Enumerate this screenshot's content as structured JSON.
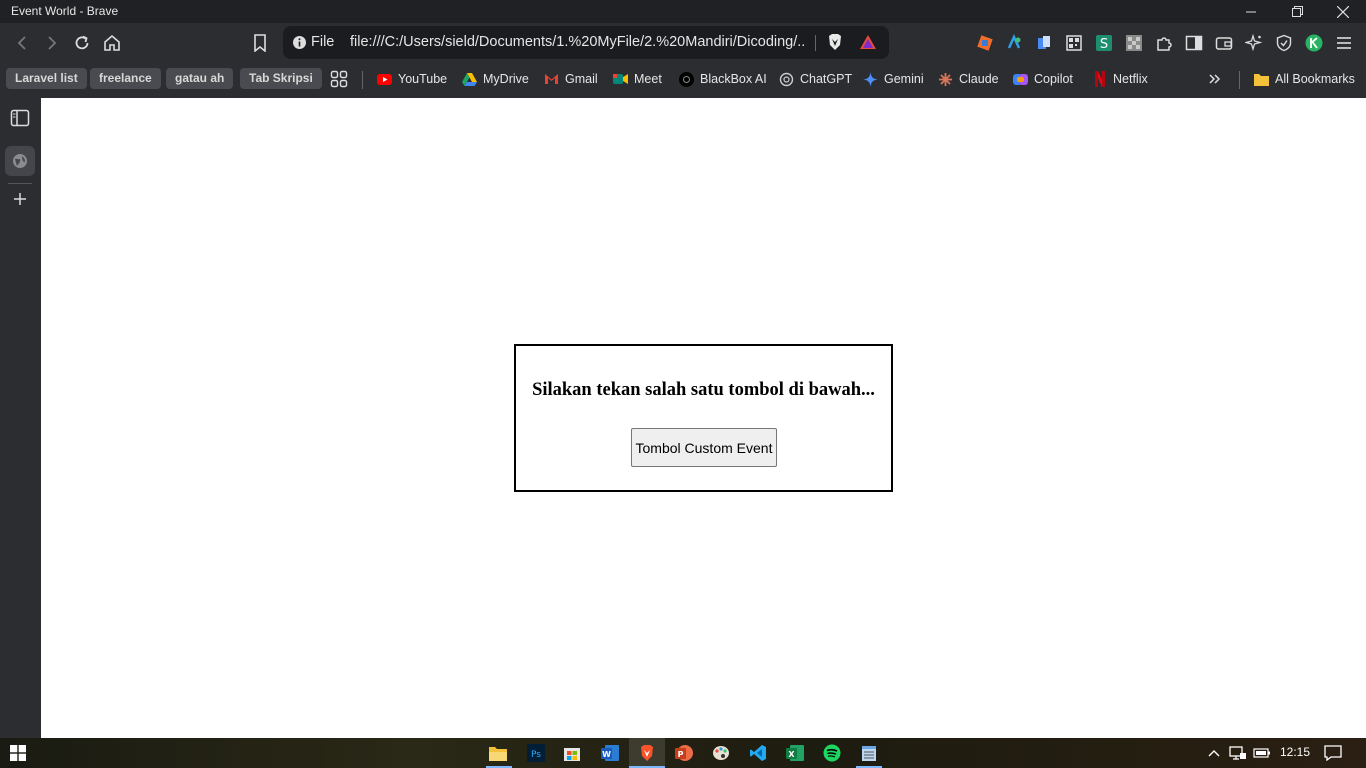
{
  "window": {
    "title": "Event World - Brave"
  },
  "nav": {
    "file_label": "File",
    "url": "file:///C:/Users/sield/Documents/1.%20MyFile/2.%20Mandiri/Dicoding/..."
  },
  "bookmarks": {
    "tags": [
      "Laravel list",
      "freelance",
      "gatau ah",
      "Tab Skripsi"
    ],
    "items": [
      {
        "label": "YouTube",
        "icon": "youtube-icon",
        "color": "#ff0000"
      },
      {
        "label": "MyDrive",
        "icon": "google-drive-icon",
        "color": "#1fa463"
      },
      {
        "label": "Gmail",
        "icon": "gmail-icon",
        "color": "#ea4335"
      },
      {
        "label": "Meet",
        "icon": "google-meet-icon",
        "color": "#00897b"
      },
      {
        "label": "BlackBox AI",
        "icon": "blackbox-icon",
        "color": "#000000"
      },
      {
        "label": "ChatGPT",
        "icon": "chatgpt-icon",
        "color": "#cccccc"
      },
      {
        "label": "Gemini",
        "icon": "gemini-icon",
        "color": "#4f8ef7"
      },
      {
        "label": "Claude",
        "icon": "claude-icon",
        "color": "#d97757"
      },
      {
        "label": "Copilot",
        "icon": "copilot-icon",
        "color": "#8a5cf6"
      },
      {
        "label": "Netflix",
        "icon": "netflix-icon",
        "color": "#e50914"
      }
    ],
    "all_bookmarks": "All Bookmarks"
  },
  "page": {
    "heading": "Silakan tekan salah satu tombol di bawah...",
    "button_label": "Tombol Custom Event"
  },
  "taskbar": {
    "time": "12:15"
  },
  "colors": {
    "chrome_bg": "#2c2d31",
    "titlebar_bg": "#202124",
    "accent": "#7bb8ff"
  }
}
